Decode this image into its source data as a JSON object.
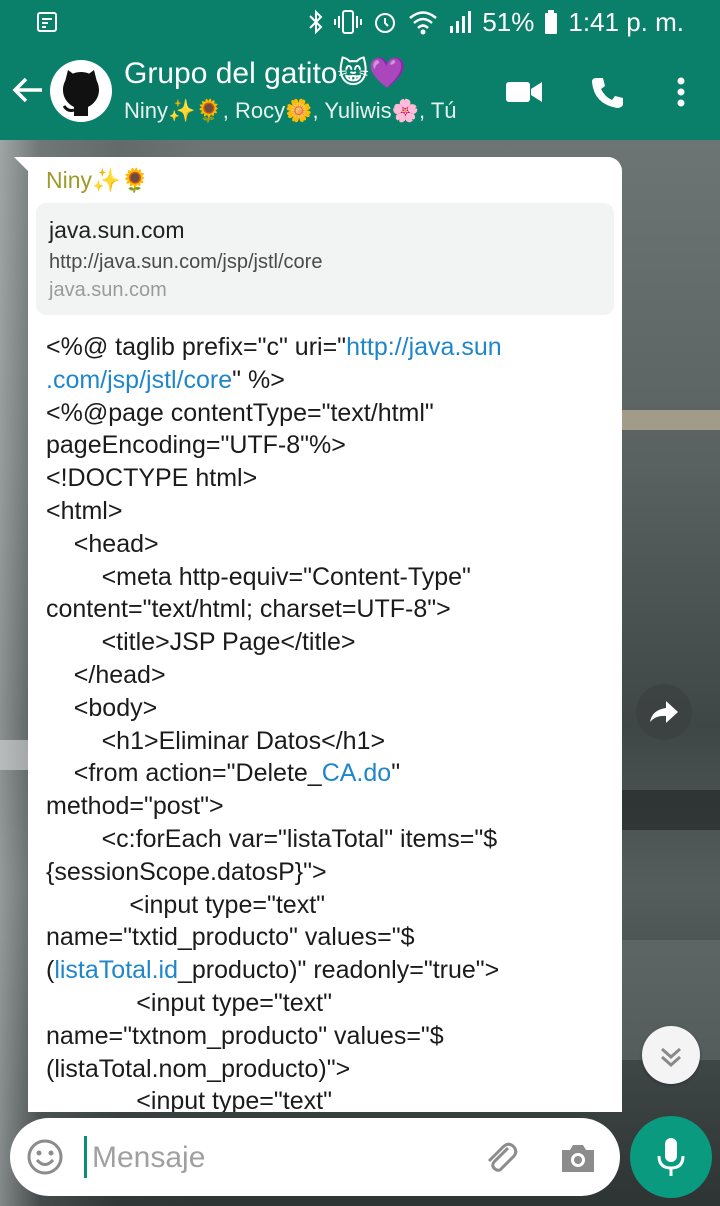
{
  "status_bar": {
    "battery": "51%",
    "time": "1:41 p. m."
  },
  "header": {
    "title": "Grupo del gatito😸💜",
    "participants": "Niny✨🌻, Rocy🌼, Yuliwis🌸, Tú"
  },
  "message": {
    "sender": "Niny✨🌻",
    "link_preview": {
      "title": "java.sun.com",
      "url": "http://java.sun.com/jsp/jstl/core",
      "domain": "java.sun.com"
    },
    "lines": [
      "<%@ taglib prefix=\"c\" uri=\"",
      "http://java.sun\n.com/jsp/jstl/core",
      "\" %>\n<%@page contentType=\"text/html\"\npageEncoding=\"UTF-8\"%>\n<!DOCTYPE html>\n<html>\n    <head>\n        <meta http-equiv=\"Content-Type\"\ncontent=\"text/html; charset=UTF-8\">\n        <title>JSP Page</title>\n    </head>\n    <body>\n        <h1>Eliminar Datos</h1>\n    <from action=\"Delete_",
      "CA.do",
      "\"\nmethod=\"post\">\n        <c:forEach var=\"listaTotal\" items=\"$\n{sessionScope.datosP}\">\n            <input type=\"text\"\nname=\"txtid_producto\" values=\"$\n(",
      "listaTotal.id",
      "_producto)\" readonly=\"true\">\n             <input type=\"text\"\nname=\"txtnom_producto\" values=\"$\n(listaTotal.nom_producto)\">\n             <input type=\"text\""
    ]
  },
  "composer": {
    "placeholder": "Mensaje"
  },
  "colors": {
    "header_bg": "#0a7f69",
    "link_blue": "#1f86c9",
    "sender_color": "#9e9b2a",
    "mic_bg": "#0a9a80"
  },
  "icons": [
    "notification-icon",
    "bluetooth-icon",
    "vibrate-icon",
    "alarm-icon",
    "wifi-icon",
    "signal-icon",
    "battery-icon",
    "back-arrow-icon",
    "group-avatar",
    "video-call-icon",
    "phone-call-icon",
    "more-vert-icon",
    "forward-icon",
    "scroll-down-icon",
    "emoji-icon",
    "attach-icon",
    "camera-icon",
    "mic-icon"
  ]
}
